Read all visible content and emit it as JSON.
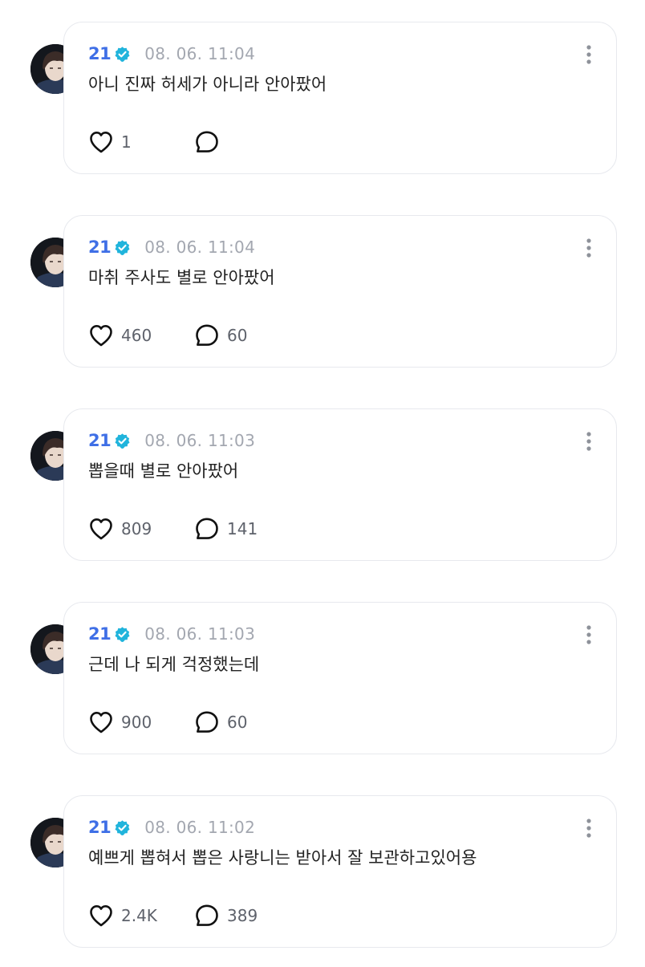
{
  "colors": {
    "author": "#3f6fe6",
    "verified": "#20b4dc",
    "timestamp": "#a3a7b0",
    "card_border": "#e7e9ee",
    "text": "#222222"
  },
  "icons": {
    "verified": "verified-badge-icon",
    "more": "more-vertical-icon",
    "like": "heart-icon",
    "comment": "comment-bubble-icon"
  },
  "posts": [
    {
      "author": "21",
      "timestamp": "08. 06. 11:04",
      "text": "아니 진짜 허세가 아니라 안아팠어",
      "likes": "1",
      "comments": ""
    },
    {
      "author": "21",
      "timestamp": "08. 06. 11:04",
      "text": "마취 주사도 별로 안아팠어",
      "likes": "460",
      "comments": "60"
    },
    {
      "author": "21",
      "timestamp": "08. 06. 11:03",
      "text": "뽑을때 별로 안아팠어",
      "likes": "809",
      "comments": "141"
    },
    {
      "author": "21",
      "timestamp": "08. 06. 11:03",
      "text": "근데 나 되게 걱정했는데",
      "likes": "900",
      "comments": "60"
    },
    {
      "author": "21",
      "timestamp": "08. 06. 11:02",
      "text": "예쁘게 뽑혀서 뽑은 사랑니는 받아서 잘 보관하고있어용",
      "likes": "2.4K",
      "comments": "389"
    }
  ]
}
